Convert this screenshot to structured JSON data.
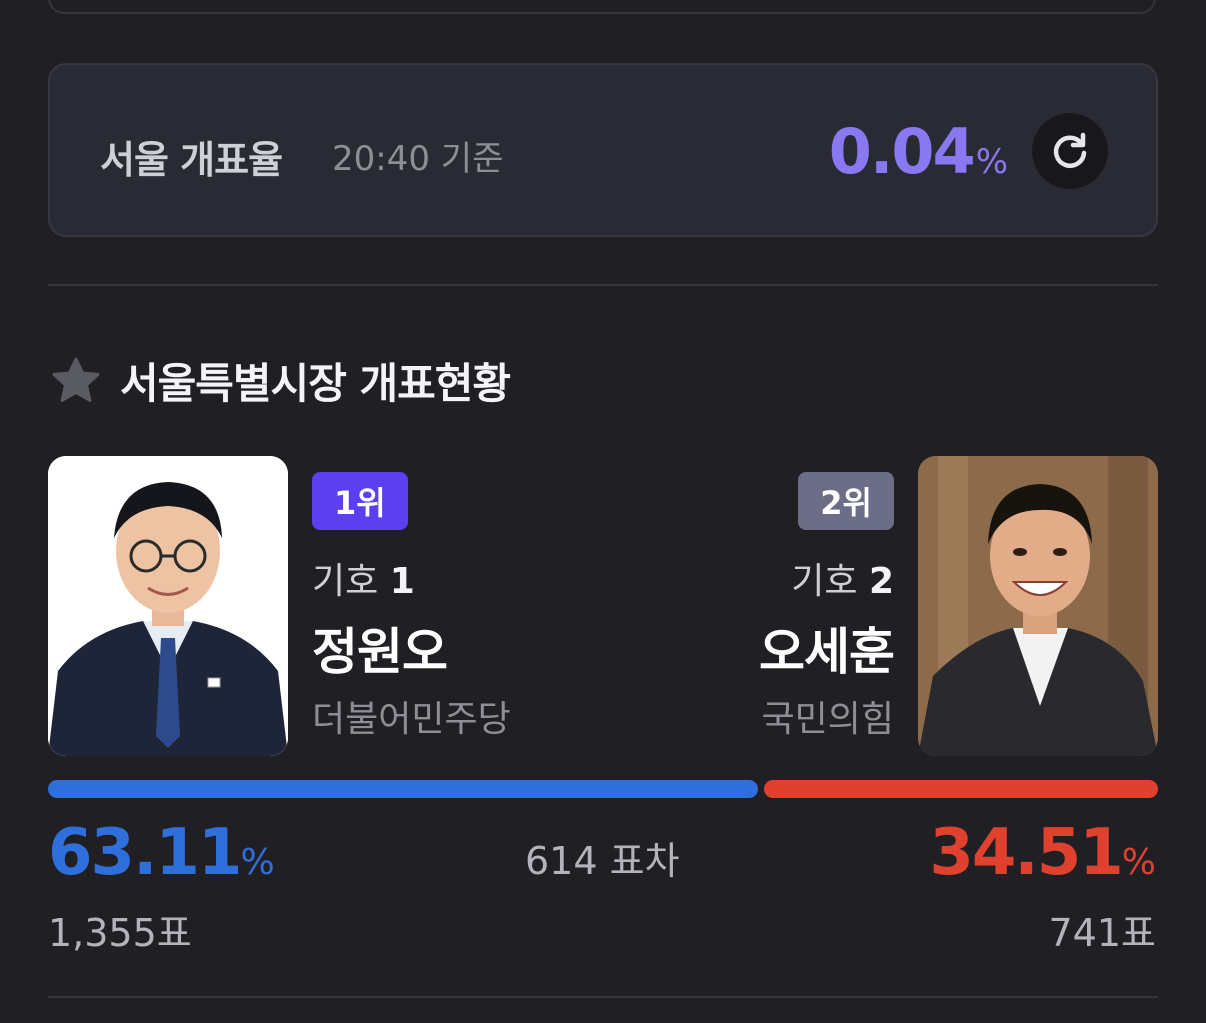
{
  "rate_card": {
    "title": "서울 개표율",
    "time": "20:40 기준",
    "value": "0.04",
    "unit": "%"
  },
  "section": {
    "title": "서울특별시장 개표현황"
  },
  "candidates": [
    {
      "rank": "1위",
      "number_label": "기호",
      "number": "1",
      "name": "정원오",
      "party": "더불어민주당",
      "percent": "63.11",
      "percent_unit": "%",
      "votes": "1,355표",
      "color": "#2f6fdb"
    },
    {
      "rank": "2위",
      "number_label": "기호",
      "number": "2",
      "name": "오세훈",
      "party": "국민의힘",
      "percent": "34.51",
      "percent_unit": "%",
      "votes": "741표",
      "color": "#e0412f"
    }
  ],
  "difference": "614 표차",
  "icons": {
    "refresh": "refresh-icon",
    "star": "star-icon"
  },
  "colors": {
    "accent": "#8a78f0",
    "rank1": "#5b3ff0",
    "rank2": "#6c6e88"
  }
}
